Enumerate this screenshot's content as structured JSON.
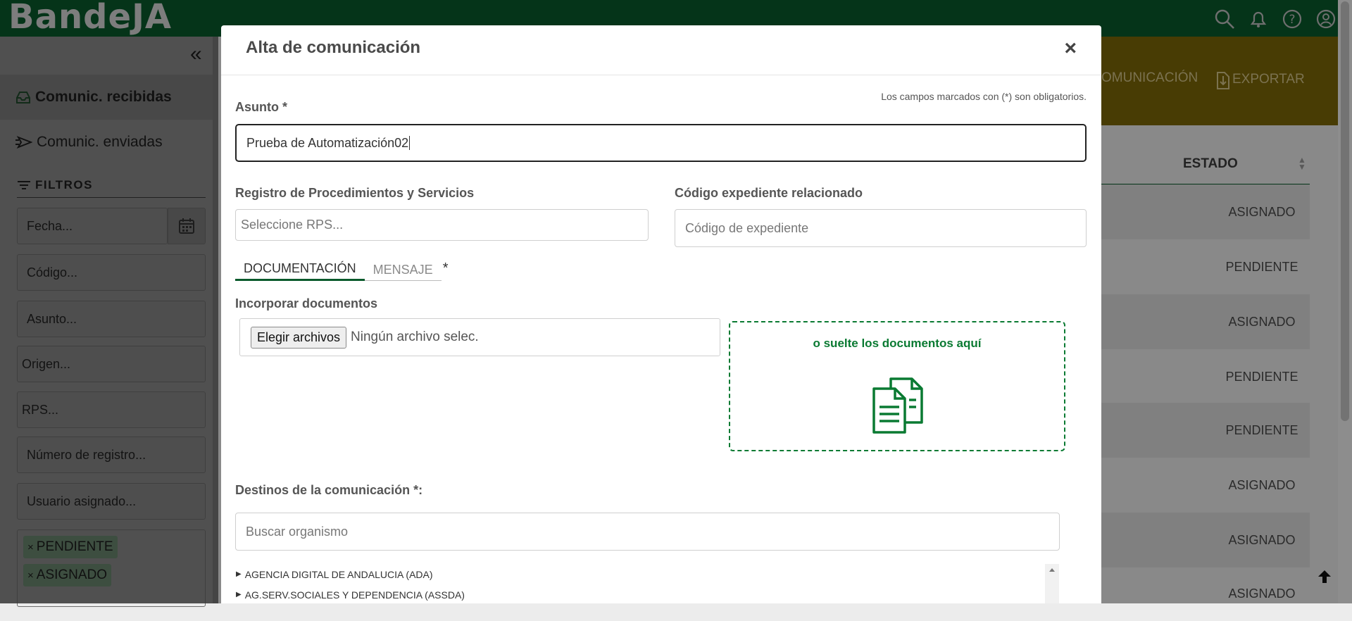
{
  "app": {
    "brand": "BandeJA"
  },
  "sidebar": {
    "items": [
      {
        "label": "Comunic. recibidas",
        "icon": "inbox-icon"
      },
      {
        "label": "Comunic. enviadas",
        "icon": "send-icon"
      }
    ],
    "filters_title": "FILTROS",
    "filters": [
      {
        "placeholder": "Fecha..."
      },
      {
        "placeholder": "Código..."
      },
      {
        "placeholder": "Asunto..."
      },
      {
        "placeholder": "Origen..."
      },
      {
        "placeholder": "RPS..."
      },
      {
        "placeholder": "Número de registro..."
      },
      {
        "placeholder": "Usuario asignado..."
      }
    ],
    "tags": [
      "PENDIENTE",
      "ASIGNADO"
    ]
  },
  "actions": {
    "new_comm": "OMUNICACIÓN",
    "export": "EXPORTAR"
  },
  "table": {
    "estado_header": "ESTADO",
    "rows": [
      "ASIGNADO",
      "PENDIENTE",
      "ASIGNADO",
      "PENDIENTE",
      "PENDIENTE",
      "ASIGNADO",
      "ASIGNADO",
      "ASIGNADO"
    ]
  },
  "modal": {
    "title": "Alta de comunicación",
    "close": "×",
    "required_note": "Los campos marcados con (*) son obligatorios.",
    "subject_label": "Asunto *",
    "subject_value": "Prueba de Automatización02",
    "rps_label": "Registro de Procedimientos y Servicios",
    "rps_placeholder": "Seleccione RPS...",
    "expediente_label": "Código expediente relacionado",
    "expediente_placeholder": "Código de expediente",
    "tabs": [
      "DOCUMENTACIÓN",
      "MENSAJE"
    ],
    "tabs_required": "*",
    "docs_label": "Incorporar documentos",
    "file_button": "Elegir archivos",
    "file_status": "Ningún archivo selec.",
    "drop_text": "o suelte los documentos aquí",
    "destinos_label": "Destinos de la comunicación *:",
    "search_placeholder": "Buscar organismo",
    "tree": [
      "AGENCIA DIGITAL DE ANDALUCIA (ADA)",
      "AG.SERV.SOCIALES Y DEPENDENCIA (ASSDA)"
    ]
  },
  "colors": {
    "header_green": "#0a5a2c",
    "accent_green": "#0a7a32",
    "action_bar": "#7d6808"
  }
}
